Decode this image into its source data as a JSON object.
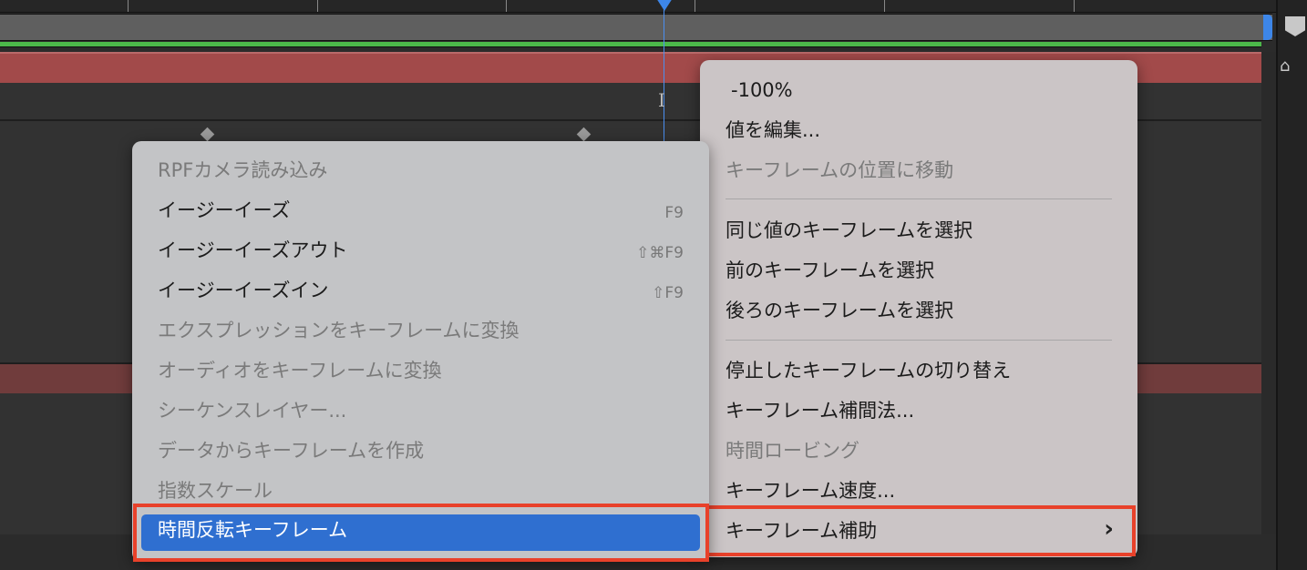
{
  "left_menu": {
    "items": [
      {
        "label": "RPFカメラ読み込み",
        "enabled": false,
        "shortcut": ""
      },
      {
        "label": "イージーイーズ",
        "enabled": true,
        "shortcut": "F9"
      },
      {
        "label": "イージーイーズアウト",
        "enabled": true,
        "shortcut": "⇧⌘F9"
      },
      {
        "label": "イージーイーズイン",
        "enabled": true,
        "shortcut": "⇧F9"
      },
      {
        "label": "エクスプレッションをキーフレームに変換",
        "enabled": false,
        "shortcut": ""
      },
      {
        "label": "オーディオをキーフレームに変換",
        "enabled": false,
        "shortcut": ""
      },
      {
        "label": "シーケンスレイヤー...",
        "enabled": false,
        "shortcut": ""
      },
      {
        "label": "データからキーフレームを作成",
        "enabled": false,
        "shortcut": ""
      },
      {
        "label": "指数スケール",
        "enabled": false,
        "shortcut": ""
      },
      {
        "label": "時間反転キーフレーム",
        "enabled": true,
        "highlighted": true,
        "shortcut": ""
      }
    ]
  },
  "right_menu": {
    "items": [
      {
        "label": "-100%",
        "enabled": true
      },
      {
        "label": "値を編集...",
        "enabled": true
      },
      {
        "label": "キーフレームの位置に移動",
        "enabled": false
      },
      {
        "label": "同じ値のキーフレームを選択",
        "enabled": true
      },
      {
        "label": "前のキーフレームを選択",
        "enabled": true
      },
      {
        "label": "後ろのキーフレームを選択",
        "enabled": true
      },
      {
        "label": "停止したキーフレームの切り替え",
        "enabled": true
      },
      {
        "label": "キーフレーム補間法...",
        "enabled": true
      },
      {
        "label": "時間ロービング",
        "enabled": false
      },
      {
        "label": "キーフレーム速度...",
        "enabled": true
      },
      {
        "label": "キーフレーム補助",
        "enabled": true,
        "submenu": true
      }
    ],
    "submenu_arrow": "›"
  },
  "colors": {
    "highlight": "#2f6fd0",
    "annotation": "#e8412a",
    "playhead": "#3d86e8"
  }
}
